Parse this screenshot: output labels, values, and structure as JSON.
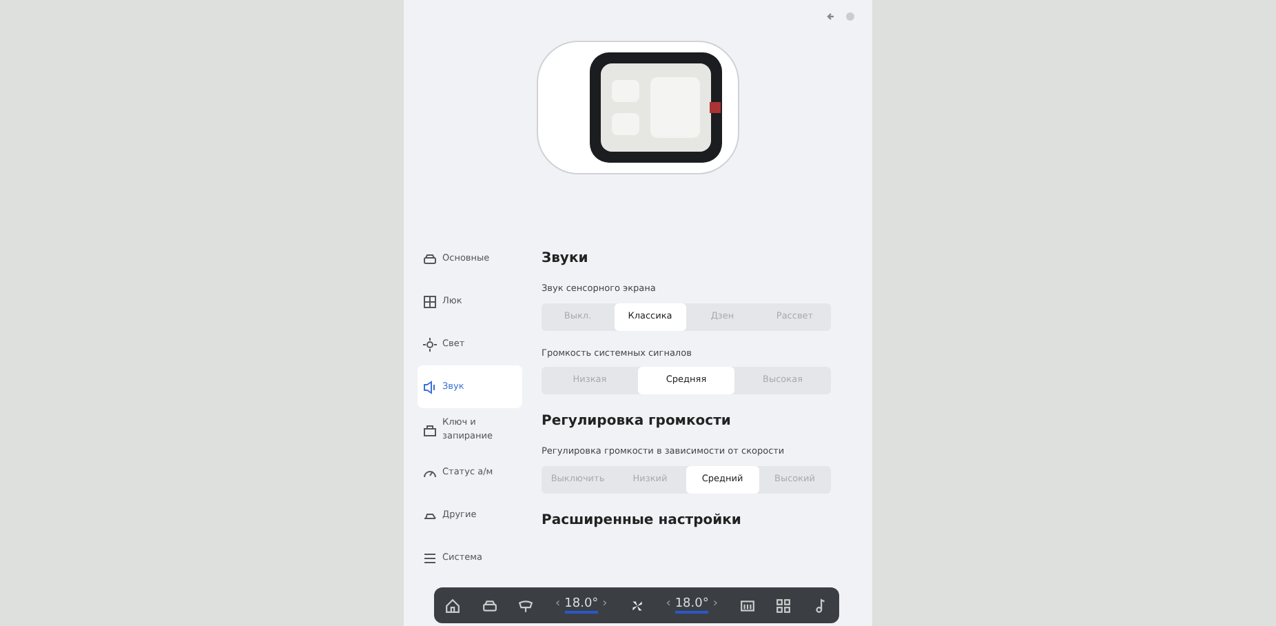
{
  "sidebar": {
    "items": [
      {
        "label": "Основные",
        "selected": false
      },
      {
        "label": "Люк",
        "selected": false
      },
      {
        "label": "Свет",
        "selected": false
      },
      {
        "label": "Звук",
        "selected": true
      },
      {
        "label": "Ключ и запирание",
        "selected": false
      },
      {
        "label": "Статус а/м",
        "selected": false
      },
      {
        "label": "Другие",
        "selected": false
      },
      {
        "label": "Система",
        "selected": false
      }
    ]
  },
  "sections": [
    {
      "heading": "Звуки",
      "settings": [
        {
          "label": "Звук сенсорного экрана",
          "options": [
            {
              "label": "Выкл.",
              "selected": false
            },
            {
              "label": "Классика",
              "selected": true
            },
            {
              "label": "Дзен",
              "selected": false
            },
            {
              "label": "Рассвет",
              "selected": false
            }
          ]
        },
        {
          "label": "Громкость системных сигналов",
          "options": [
            {
              "label": "Низкая",
              "selected": false
            },
            {
              "label": "Средняя",
              "selected": true
            },
            {
              "label": "Высокая",
              "selected": false
            }
          ]
        }
      ]
    },
    {
      "heading": "Регулировка громкости",
      "settings": [
        {
          "label": "Регулировка громкости в зависимости от скорости",
          "options": [
            {
              "label": "Выключить",
              "selected": false
            },
            {
              "label": "Низкий",
              "selected": false
            },
            {
              "label": "Средний",
              "selected": true
            },
            {
              "label": "Высокий",
              "selected": false
            }
          ]
        }
      ]
    },
    {
      "heading": "Расширенные настройки"
    }
  ],
  "dock": {
    "left_temp": {
      "prev": "‹",
      "value": "18.0°",
      "next": "›"
    },
    "right_temp": {
      "prev": "‹",
      "value": "18.0°",
      "next": "›"
    }
  }
}
